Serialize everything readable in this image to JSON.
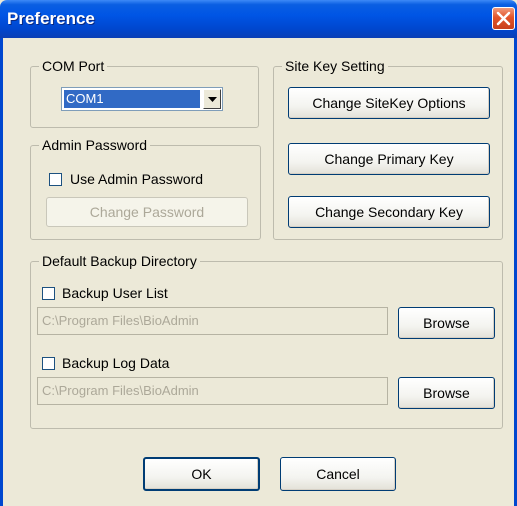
{
  "window": {
    "title": "Preference"
  },
  "com_port": {
    "legend": "COM Port",
    "selected": "COM1"
  },
  "admin_password": {
    "legend": "Admin Password",
    "use_label": "Use Admin Password",
    "change_label": "Change Password"
  },
  "site_key": {
    "legend": "Site Key Setting",
    "options_label": "Change SiteKey Options",
    "primary_label": "Change Primary Key",
    "secondary_label": "Change Secondary Key"
  },
  "backup": {
    "legend": "Default Backup Directory",
    "user_list_label": "Backup User List",
    "user_list_path": "C:\\Program Files\\BioAdmin",
    "log_data_label": "Backup Log Data",
    "log_data_path": "C:\\Program Files\\BioAdmin",
    "browse_label": "Browse"
  },
  "footer": {
    "ok_label": "OK",
    "cancel_label": "Cancel"
  },
  "colors": {
    "titlebar": "#0055e5",
    "dialog_bg": "#ece9d8",
    "close": "#e2542a"
  }
}
